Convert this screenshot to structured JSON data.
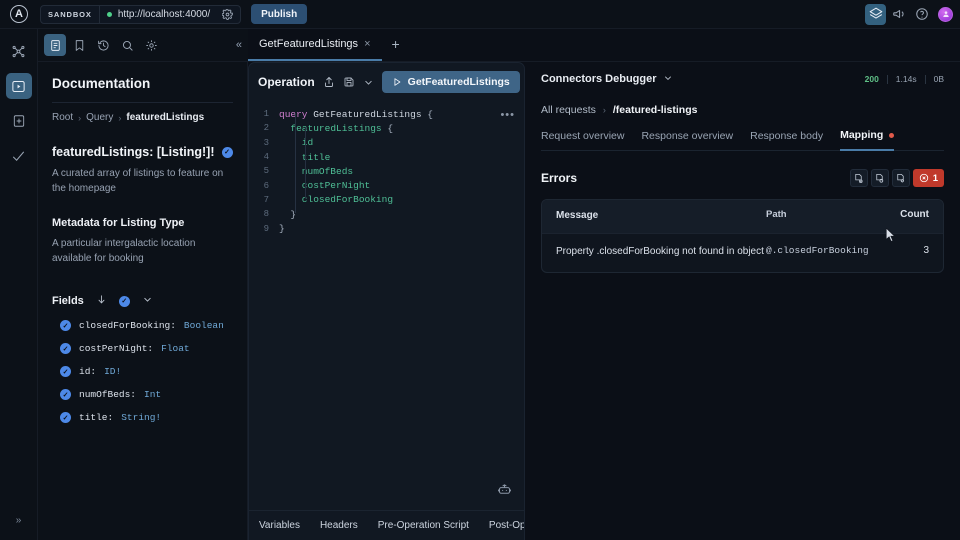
{
  "topbar": {
    "logo_letter": "A",
    "env_chip": "SANDBOX",
    "url": "http://localhost:4000/",
    "publish_label": "Publish",
    "icons": [
      "layers-icon",
      "megaphone-icon",
      "help-circle-icon",
      "avatar"
    ]
  },
  "rail": {
    "items": [
      {
        "name": "graph-icon"
      },
      {
        "name": "explorer-icon"
      },
      {
        "name": "schema-icon"
      },
      {
        "name": "checks-icon"
      }
    ],
    "expand_label": "»"
  },
  "toolbar": {
    "icons": [
      "documentation-icon",
      "bookmark-icon",
      "history-icon",
      "search-icon",
      "settings-icon"
    ],
    "collapse_label": "«"
  },
  "tabs": {
    "items": [
      {
        "label": "GetFeaturedListings",
        "close": "×"
      }
    ],
    "add_label": "+"
  },
  "documentation": {
    "title": "Documentation",
    "breadcrumb": [
      "Root",
      "Query",
      "featuredListings"
    ],
    "heading": "featuredListings: [Listing!]!",
    "description": "A curated array of listings to feature on the homepage",
    "subheading": "Metadata for Listing Type",
    "sub_description": "A particular intergalactic location available for booking",
    "fields_label": "Fields",
    "fields": [
      {
        "name": "closedForBooking:",
        "type": "Boolean"
      },
      {
        "name": "costPerNight:",
        "type": "Float"
      },
      {
        "name": "id:",
        "type": "ID!"
      },
      {
        "name": "numOfBeds:",
        "type": "Int"
      },
      {
        "name": "title:",
        "type": "String!"
      }
    ]
  },
  "operation": {
    "title": "Operation",
    "run_label": "GetFeaturedListings",
    "code_lines": [
      {
        "n": "1",
        "indent": 0,
        "parts": [
          {
            "t": "query ",
            "c": "kw"
          },
          {
            "t": "GetFeaturedListings ",
            "c": "name"
          },
          {
            "t": "{",
            "c": "brace"
          }
        ]
      },
      {
        "n": "2",
        "indent": 1,
        "parts": [
          {
            "t": "featuredListings ",
            "c": "field"
          },
          {
            "t": "{",
            "c": "brace"
          }
        ]
      },
      {
        "n": "3",
        "indent": 2,
        "parts": [
          {
            "t": "id",
            "c": "field"
          }
        ]
      },
      {
        "n": "4",
        "indent": 2,
        "parts": [
          {
            "t": "title",
            "c": "field"
          }
        ]
      },
      {
        "n": "5",
        "indent": 2,
        "parts": [
          {
            "t": "numOfBeds",
            "c": "field"
          }
        ]
      },
      {
        "n": "6",
        "indent": 2,
        "parts": [
          {
            "t": "costPerNight",
            "c": "field"
          }
        ]
      },
      {
        "n": "7",
        "indent": 2,
        "parts": [
          {
            "t": "closedForBooking",
            "c": "field"
          }
        ]
      },
      {
        "n": "8",
        "indent": 1,
        "parts": [
          {
            "t": "}",
            "c": "brace"
          }
        ]
      },
      {
        "n": "9",
        "indent": 0,
        "parts": [
          {
            "t": "}",
            "c": "brace"
          }
        ]
      }
    ],
    "more_label": "•••",
    "bottom_tabs": [
      "Variables",
      "Headers",
      "Pre-Operation Script",
      "Post-Ope"
    ]
  },
  "debugger": {
    "title": "Connectors Debugger",
    "status_code": "200",
    "duration": "1.14s",
    "size": "0B",
    "breadcrumb": [
      "All requests",
      "/featured-listings"
    ],
    "tabs": [
      {
        "label": "Request overview",
        "selected": false,
        "dot": false
      },
      {
        "label": "Response overview",
        "selected": false,
        "dot": false
      },
      {
        "label": "Response body",
        "selected": false,
        "dot": false
      },
      {
        "label": "Mapping",
        "selected": true,
        "dot": true
      }
    ],
    "errors_title": "Errors",
    "error_count": "1",
    "action_icons": [
      "copy-document-icon",
      "duplicate-document-icon",
      "document-settings-icon"
    ],
    "table": {
      "columns": [
        "Message",
        "Path",
        "Count"
      ],
      "rows": [
        {
          "message": "Property .closedForBooking not found in object",
          "path": "@.closedForBooking",
          "count": "3"
        }
      ]
    }
  },
  "colors": {
    "accent_blue": "#4a7ca8",
    "error_red": "#c0392b",
    "status_green": "#5fbf86",
    "graphql_pink": "#d07fd0",
    "field_green": "#4fbf96"
  }
}
